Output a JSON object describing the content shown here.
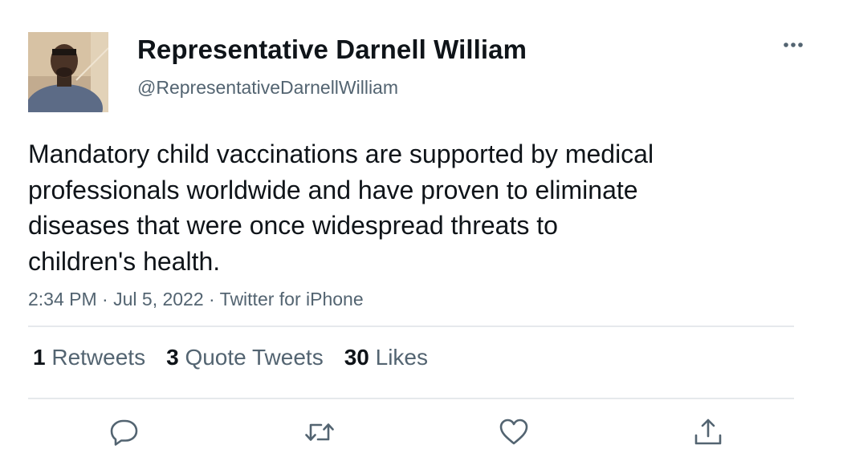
{
  "user": {
    "display_name": "Representative Darnell William",
    "handle": "@RepresentativeDarnellWilliam"
  },
  "tweet": {
    "text_lines": [
      "Mandatory child vaccinations are supported by medical",
      "professionals worldwide and have proven to eliminate",
      "diseases that were once widespread threats to",
      "children's health."
    ],
    "time": "2:34 PM",
    "date": "Jul 5, 2022",
    "source": "Twitter for iPhone",
    "separator": " · "
  },
  "stats": {
    "retweets": {
      "count": "1",
      "label": "Retweets"
    },
    "quotes": {
      "count": "3",
      "label": "Quote Tweets"
    },
    "likes": {
      "count": "30",
      "label": "Likes"
    }
  },
  "icons": {
    "more": "more-icon",
    "reply": "reply-icon",
    "retweet": "retweet-icon",
    "like": "like-icon",
    "share": "share-icon"
  },
  "colors": {
    "text_primary": "#0f1419",
    "text_secondary": "#536471",
    "divider": "#e6e9ec",
    "icon": "#536471"
  }
}
